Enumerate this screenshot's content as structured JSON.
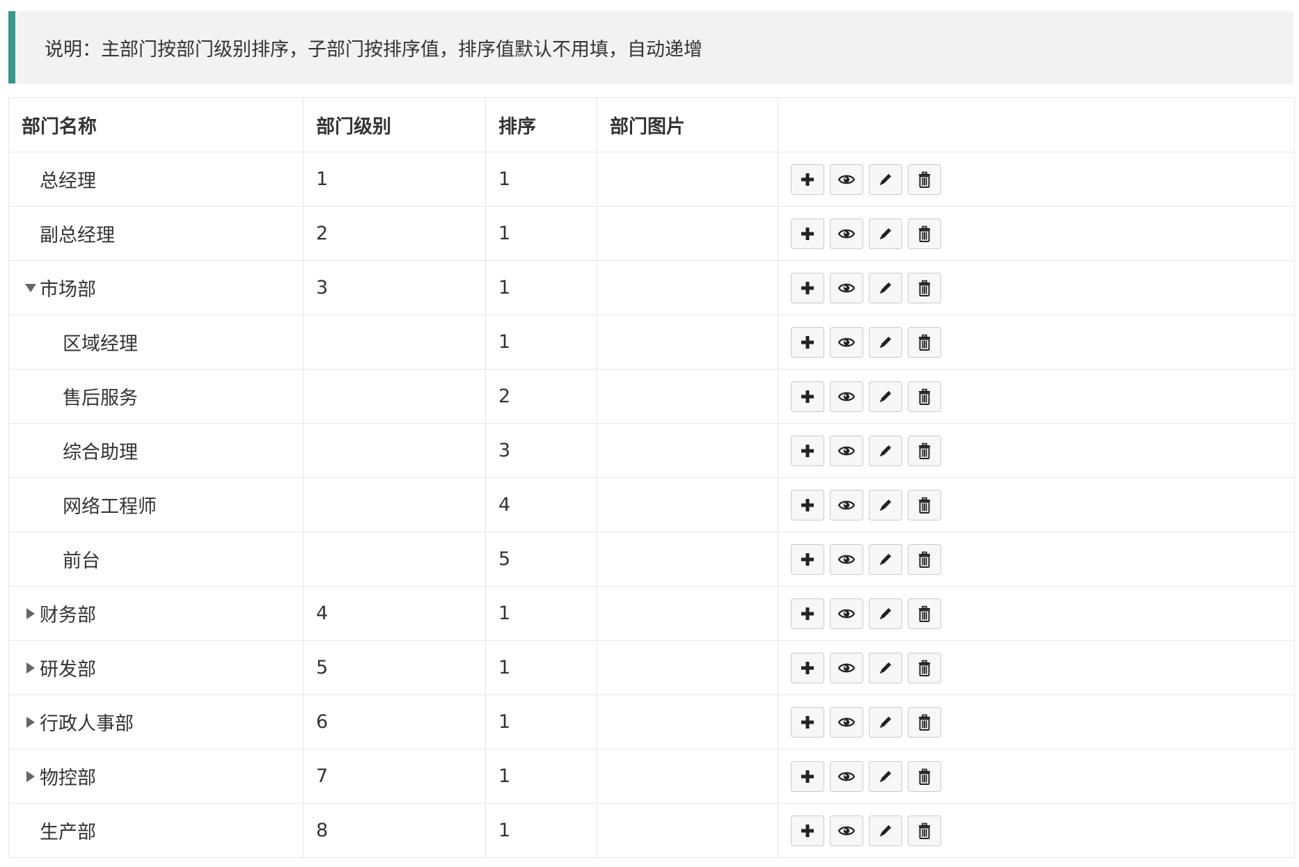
{
  "note": {
    "text": "说明：主部门按部门级别排序，子部门按排序值，排序值默认不用填，自动递增"
  },
  "table": {
    "headers": [
      "部门名称",
      "部门级别",
      "排序",
      "部门图片",
      ""
    ],
    "rows": [
      {
        "name": "总经理",
        "level": "1",
        "sort": "1",
        "image": "",
        "indent": 0,
        "toggle": "none"
      },
      {
        "name": "副总经理",
        "level": "2",
        "sort": "1",
        "image": "",
        "indent": 0,
        "toggle": "none"
      },
      {
        "name": "市场部",
        "level": "3",
        "sort": "1",
        "image": "",
        "indent": 0,
        "toggle": "expanded"
      },
      {
        "name": "区域经理",
        "level": "",
        "sort": "1",
        "image": "",
        "indent": 1,
        "toggle": "none"
      },
      {
        "name": "售后服务",
        "level": "",
        "sort": "2",
        "image": "",
        "indent": 1,
        "toggle": "none"
      },
      {
        "name": "综合助理",
        "level": "",
        "sort": "3",
        "image": "",
        "indent": 1,
        "toggle": "none"
      },
      {
        "name": "网络工程师",
        "level": "",
        "sort": "4",
        "image": "",
        "indent": 1,
        "toggle": "none"
      },
      {
        "name": "前台",
        "level": "",
        "sort": "5",
        "image": "",
        "indent": 1,
        "toggle": "none"
      },
      {
        "name": "财务部",
        "level": "4",
        "sort": "1",
        "image": "",
        "indent": 0,
        "toggle": "collapsed"
      },
      {
        "name": "研发部",
        "level": "5",
        "sort": "1",
        "image": "",
        "indent": 0,
        "toggle": "collapsed"
      },
      {
        "name": "行政人事部",
        "level": "6",
        "sort": "1",
        "image": "",
        "indent": 0,
        "toggle": "collapsed"
      },
      {
        "name": "物控部",
        "level": "7",
        "sort": "1",
        "image": "",
        "indent": 0,
        "toggle": "collapsed"
      },
      {
        "name": "生产部",
        "level": "8",
        "sort": "1",
        "image": "",
        "indent": 0,
        "toggle": "none"
      }
    ],
    "actions": [
      {
        "icon": "plus-icon",
        "name": "add-button"
      },
      {
        "icon": "eye-icon",
        "name": "view-button"
      },
      {
        "icon": "pencil-icon",
        "name": "edit-button"
      },
      {
        "icon": "trash-icon",
        "name": "delete-button"
      }
    ]
  },
  "colors": {
    "accent": "#3a9688",
    "note_bg": "#f2f2f2",
    "border": "#e6e6e6"
  }
}
